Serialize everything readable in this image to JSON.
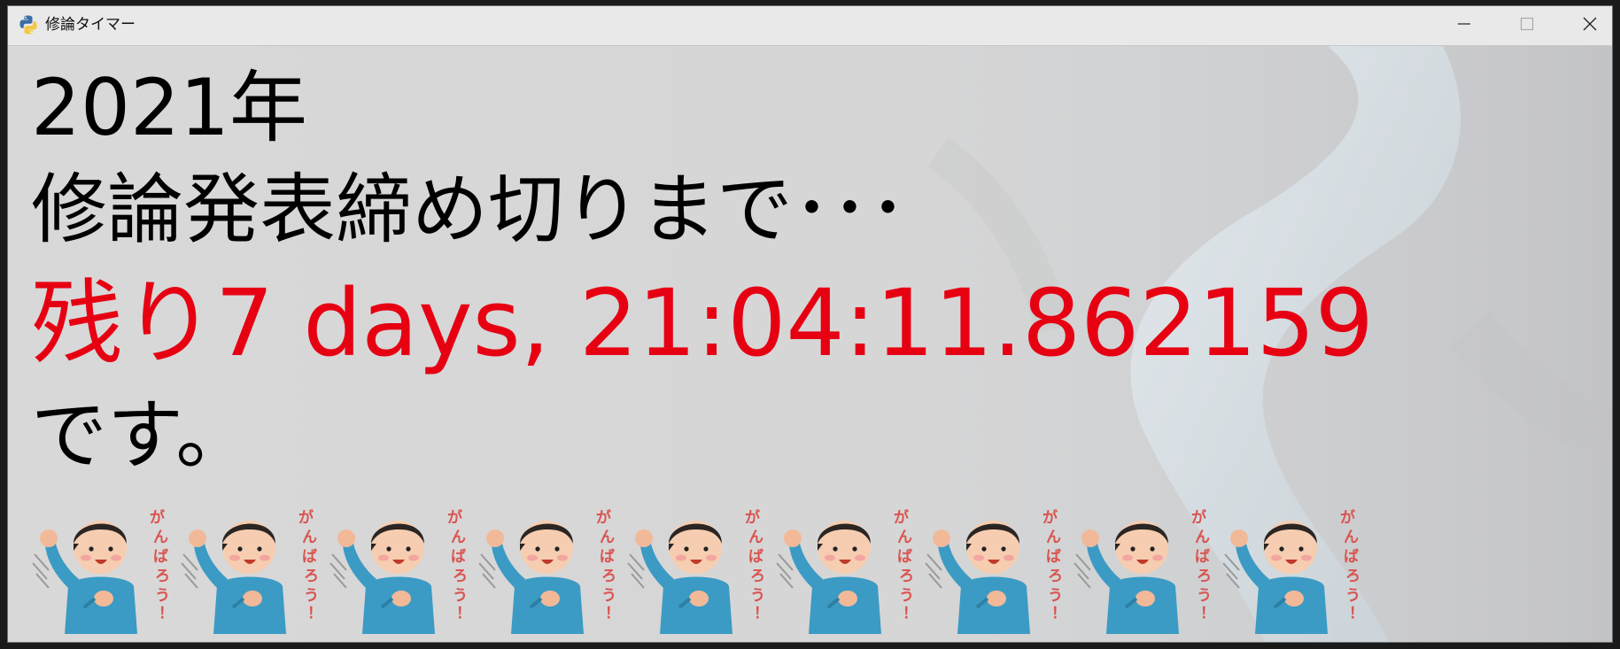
{
  "window": {
    "title": "修論タイマー"
  },
  "timer": {
    "year_line": "2021年",
    "deadline_line": "修論発表締め切りまで･･･",
    "remaining_line": "残り7 days, 21:04:11.862159",
    "desu_line": "です。"
  },
  "mascots": {
    "count": 9,
    "caption": "がんばろう！"
  },
  "colors": {
    "remaining_text": "#e60012",
    "body_text": "#000000",
    "window_bg": "#dcdcdc"
  },
  "icons": {
    "app": "python-icon",
    "minimize": "minimize-icon",
    "maximize": "maximize-icon",
    "close": "close-icon"
  }
}
